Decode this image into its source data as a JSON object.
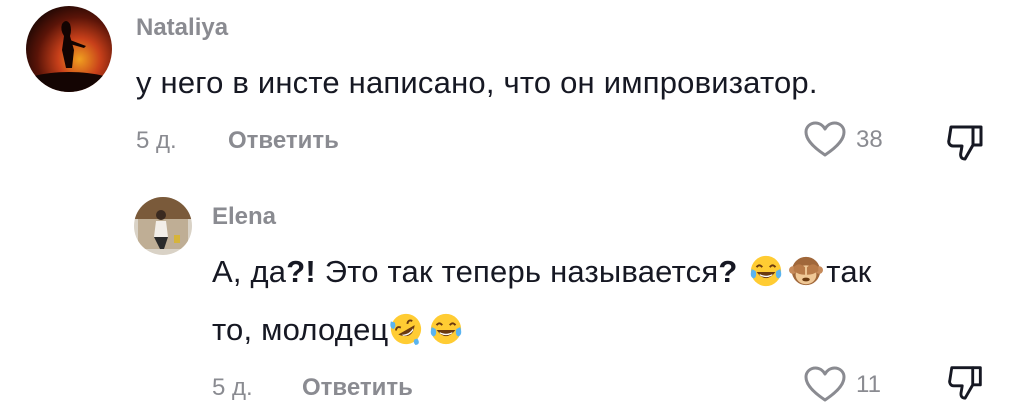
{
  "comments": [
    {
      "username": "Nataliya",
      "text": "у него в инсте написано, что он импровизатор.",
      "time": "5 д.",
      "reply_label": "Ответить",
      "likes": "38",
      "avatar_icon": "sunset-silhouette-avatar"
    },
    {
      "username": "Elena",
      "text_line1_a": "А, да",
      "text_line1_b": "?!",
      "text_line1_c": " Это так теперь называется",
      "text_line1_d": "?",
      "text_line1_e": "так",
      "text_line2": "то, молодец",
      "time": "5 д.",
      "reply_label": "Ответить",
      "likes": "11",
      "avatar_icon": "woman-photo-avatar",
      "emojis": [
        "face-with-tears-of-joy",
        "see-no-evil-monkey",
        "rolling-on-floor-laughing",
        "face-with-tears-of-joy"
      ]
    }
  ],
  "colors": {
    "text": "#161823",
    "muted": "#8a8b91",
    "background": "#ffffff"
  }
}
